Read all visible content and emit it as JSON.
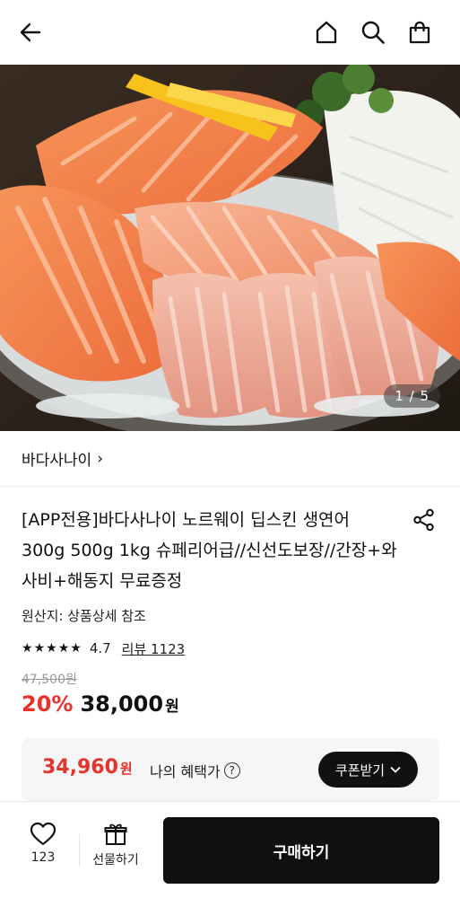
{
  "header": {
    "icons": [
      "back-arrow-icon",
      "home-icon",
      "search-icon",
      "shopping-bag-icon"
    ]
  },
  "gallery": {
    "counter": "1 / 5"
  },
  "seller": {
    "name": "바다사나이",
    "chevron": "›"
  },
  "product": {
    "title": "[APP전용]바다사나이 노르웨이 딥스킨 생연어 300g 500g 1kg 슈페리어급//신선도보장//간장+와사비+해동지 무료증정",
    "origin": "원산지: 상품상세 참조",
    "rating": "4.7",
    "rating_value": 4.7,
    "stars": [
      "★",
      "★",
      "★",
      "★",
      "★"
    ],
    "review_link": "리뷰 1123",
    "original_price": "47,500원",
    "discount": "20%",
    "price": "38,000",
    "price_unit": "원"
  },
  "benefit": {
    "price": "34,960",
    "unit": "원",
    "label": "나의 혜택가",
    "info": "?",
    "coupon_button": "쿠폰받기",
    "coupon_chevron": "⌄"
  },
  "bottom_bar": {
    "like_count": "123",
    "gift_label": "선물하기",
    "buy_label": "구매하기"
  },
  "colors": {
    "accent_red": "#e8322c",
    "dark": "#111111",
    "box_bg": "#f6f6f6"
  }
}
